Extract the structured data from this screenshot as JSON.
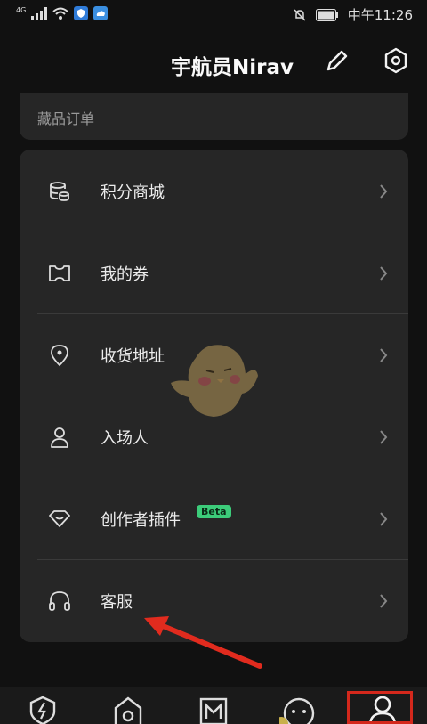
{
  "status_bar": {
    "network": "4G",
    "time": "中午11:26"
  },
  "header": {
    "title": "宇航员Nirav"
  },
  "orders": {
    "label": "藏品订单"
  },
  "menu": {
    "items": [
      {
        "label": "积分商城",
        "icon": "coin-stack-icon"
      },
      {
        "label": "我的券",
        "icon": "ticket-icon"
      },
      {
        "label": "收货地址",
        "icon": "location-pin-icon"
      },
      {
        "label": "入场人",
        "icon": "person-icon"
      },
      {
        "label": "创作者插件",
        "icon": "plugin-tag-icon",
        "badge": "Beta"
      },
      {
        "label": "客服",
        "icon": "headphones-icon"
      }
    ]
  },
  "colors": {
    "background": "#111111",
    "card": "#262626",
    "beta_badge": "#3ccc7a",
    "highlight": "#d4281c"
  },
  "tabbar": {
    "tabs": [
      {
        "icon": "lightning-shield-icon"
      },
      {
        "icon": "home-icon"
      },
      {
        "icon": "meta-m-icon"
      },
      {
        "icon": "chat-bubble-icon"
      },
      {
        "icon": "profile-icon",
        "active": true
      }
    ]
  }
}
